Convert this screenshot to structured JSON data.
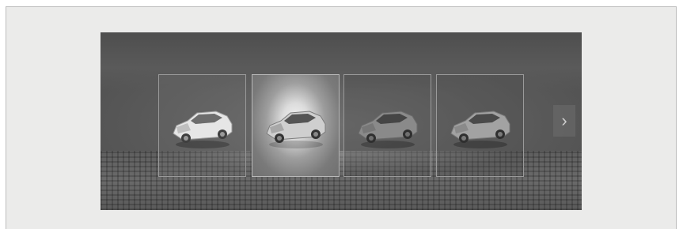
{
  "screen": {
    "vehicles": [
      {
        "id": "vehicle-1",
        "icon": "car-icon",
        "state": "normal"
      },
      {
        "id": "vehicle-2",
        "icon": "car-icon",
        "state": "selected"
      },
      {
        "id": "vehicle-3",
        "icon": "car-icon",
        "state": "dim"
      },
      {
        "id": "vehicle-4",
        "icon": "car-icon",
        "state": "dim"
      }
    ],
    "next_icon": "chevron-right-icon",
    "next_glyph": "›"
  },
  "colors": {
    "frame_background": "#ebebea",
    "screen_background": "#5d5d5d",
    "tile_border": "#9a9a9a"
  }
}
